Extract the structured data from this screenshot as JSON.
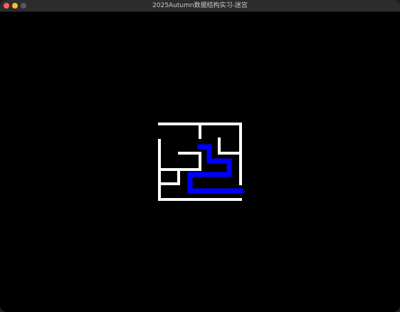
{
  "window": {
    "title": "2025Autumn数据结构实习-迷宫"
  },
  "maze": {
    "wall_color": "#ffffff",
    "path_color": "#0000ff",
    "background_color": "#000000"
  },
  "colors": {
    "close": "#ff5f57",
    "minimize": "#febc2e",
    "maximize": "#5a5a5c"
  }
}
